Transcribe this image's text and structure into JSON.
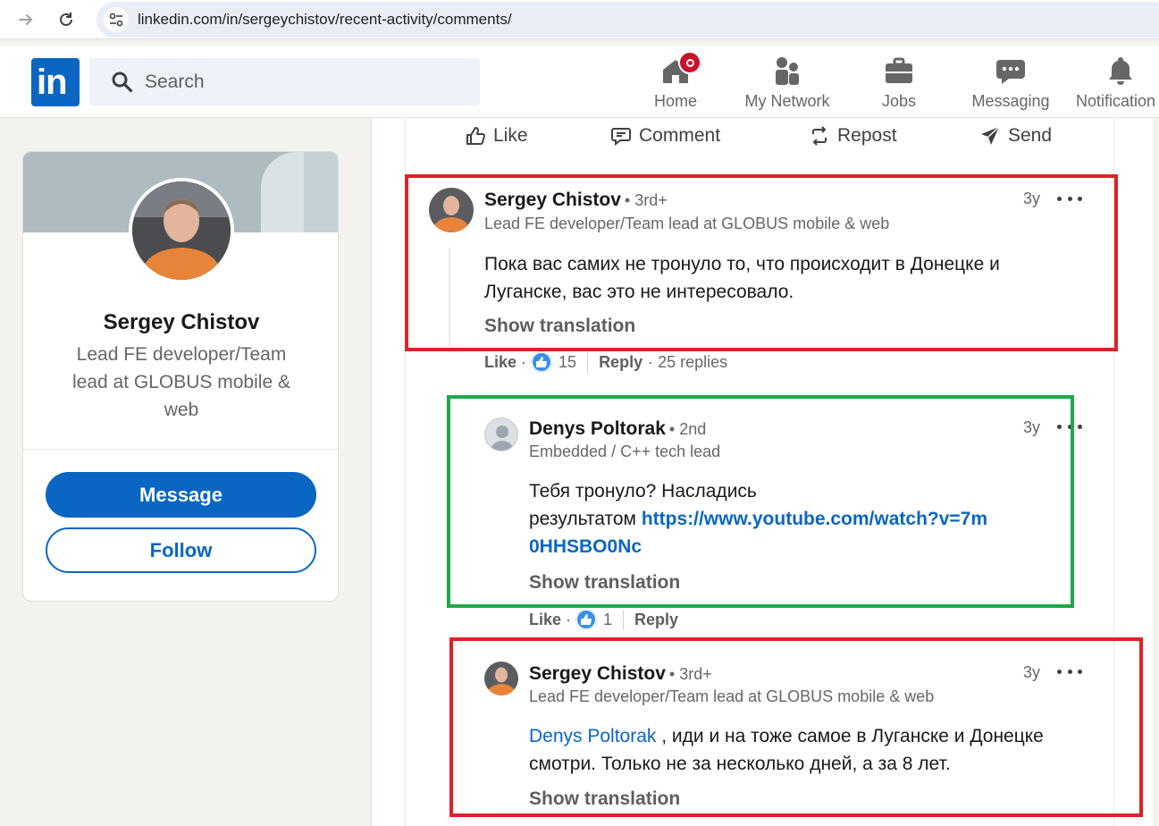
{
  "browser": {
    "url": "linkedin.com/in/sergeychistov/recent-activity/comments/"
  },
  "header": {
    "logo_text": "in",
    "search_placeholder": "Search",
    "nav": [
      {
        "label": "Home",
        "icon": "home-icon"
      },
      {
        "label": "My Network",
        "icon": "network-icon"
      },
      {
        "label": "Jobs",
        "icon": "briefcase-icon"
      },
      {
        "label": "Messaging",
        "icon": "messaging-icon"
      },
      {
        "label": "Notification",
        "icon": "bell-icon"
      }
    ]
  },
  "profile": {
    "name": "Sergey Chistov",
    "headline": "Lead FE developer/Team lead at GLOBUS mobile & web",
    "message_label": "Message",
    "follow_label": "Follow"
  },
  "post_actions": {
    "like": "Like",
    "comment": "Comment",
    "repost": "Repost",
    "send": "Send"
  },
  "comments": [
    {
      "author": "Sergey Chistov",
      "degree": "• 3rd+",
      "headline": "Lead FE developer/Team lead at GLOBUS mobile & web",
      "time": "3y",
      "text": "Пока вас самих не тронуло то, что происходит в Донецке и Луганске, вас это не интересовало.",
      "translate": "Show translation",
      "like_label": "Like",
      "dot": "·",
      "reactions": "15",
      "reply_label": "Reply",
      "replies": "· 25 replies"
    },
    {
      "author": "Denys Poltorak",
      "degree": "• 2nd",
      "headline": "Embedded / C++ tech lead",
      "time": "3y",
      "text_line1": "Тебя тронуло? Насладись",
      "text_prefix": "результатом ",
      "link": "https://www.youtube.com/watch?v=7m0HHSBO0Nc",
      "translate": "Show translation",
      "like_label": "Like",
      "dot": "·",
      "reactions": "1",
      "reply_label": "Reply"
    },
    {
      "author": "Sergey Chistov",
      "degree": "• 3rd+",
      "headline": "Lead FE developer/Team lead at GLOBUS mobile & web",
      "time": "3y",
      "mention": "Denys Poltorak",
      "text": " , иди и на тоже самое в Луганске и Донецке смотри. Только не за несколько дней, а за 8 лет.",
      "translate": "Show translation"
    }
  ],
  "colors": {
    "brand": "#0a66c2",
    "highlight_red": "#e0202a",
    "highlight_green": "#1ea84a",
    "notification_badge": "#cb112d"
  }
}
